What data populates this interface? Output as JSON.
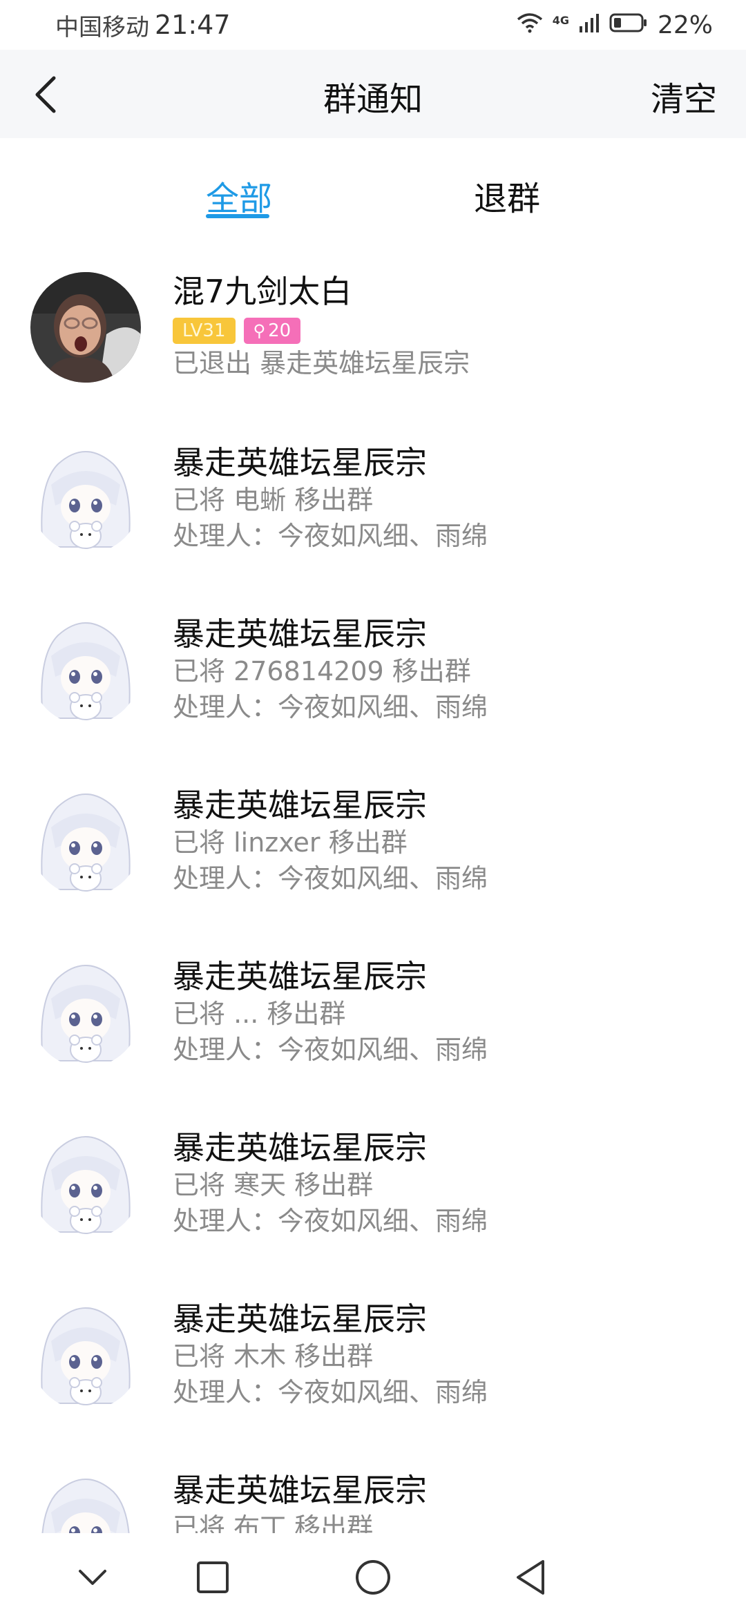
{
  "status_bar": {
    "carrier": "中国移动",
    "time": "21:47",
    "network": "4G",
    "battery": "22%",
    "icons": [
      "wifi-icon",
      "signal-icon",
      "battery-icon"
    ]
  },
  "navbar": {
    "title": "群通知",
    "clear_label": "清空",
    "back_icon": "chevron-left-icon"
  },
  "tabs": [
    {
      "label": "全部",
      "active": true
    },
    {
      "label": "退群",
      "active": false
    }
  ],
  "colors": {
    "accent": "#1e9ae6",
    "badge_level": "#f8c63a",
    "badge_pink": "#f56fb8",
    "secondary_text": "#8a8a8a"
  },
  "notifications": [
    {
      "title": "混7九剑太白",
      "badges": {
        "level": "LV31",
        "count": "20",
        "count_icon": "key-icon"
      },
      "line1": "已退出 暴走英雄坛星辰宗",
      "avatar": "photo-avatar"
    },
    {
      "title": "暴走英雄坛星辰宗",
      "line1": "已将 电蜥 移出群",
      "line2": "处理人：今夜如风细、雨绵",
      "avatar": "anime-avatar"
    },
    {
      "title": "暴走英雄坛星辰宗",
      "line1": "已将 276814209 移出群",
      "line2": "处理人：今夜如风细、雨绵",
      "avatar": "anime-avatar"
    },
    {
      "title": "暴走英雄坛星辰宗",
      "line1": "已将 linzxer 移出群",
      "line2": "处理人：今夜如风细、雨绵",
      "avatar": "anime-avatar"
    },
    {
      "title": "暴走英雄坛星辰宗",
      "line1": "已将 ... 移出群",
      "line2": "处理人：今夜如风细、雨绵",
      "avatar": "anime-avatar"
    },
    {
      "title": "暴走英雄坛星辰宗",
      "line1": "已将 寒天 移出群",
      "line2": "处理人：今夜如风细、雨绵",
      "avatar": "anime-avatar"
    },
    {
      "title": "暴走英雄坛星辰宗",
      "line1": "已将 木木 移出群",
      "line2": "处理人：今夜如风细、雨绵",
      "avatar": "anime-avatar"
    },
    {
      "title": "暴走英雄坛星辰宗",
      "line1": "已将 布丁 移出群",
      "line2": "",
      "avatar": "anime-avatar"
    }
  ],
  "system_nav": [
    "chevron-down-icon",
    "recents-icon",
    "home-icon",
    "back-triangle-icon"
  ]
}
